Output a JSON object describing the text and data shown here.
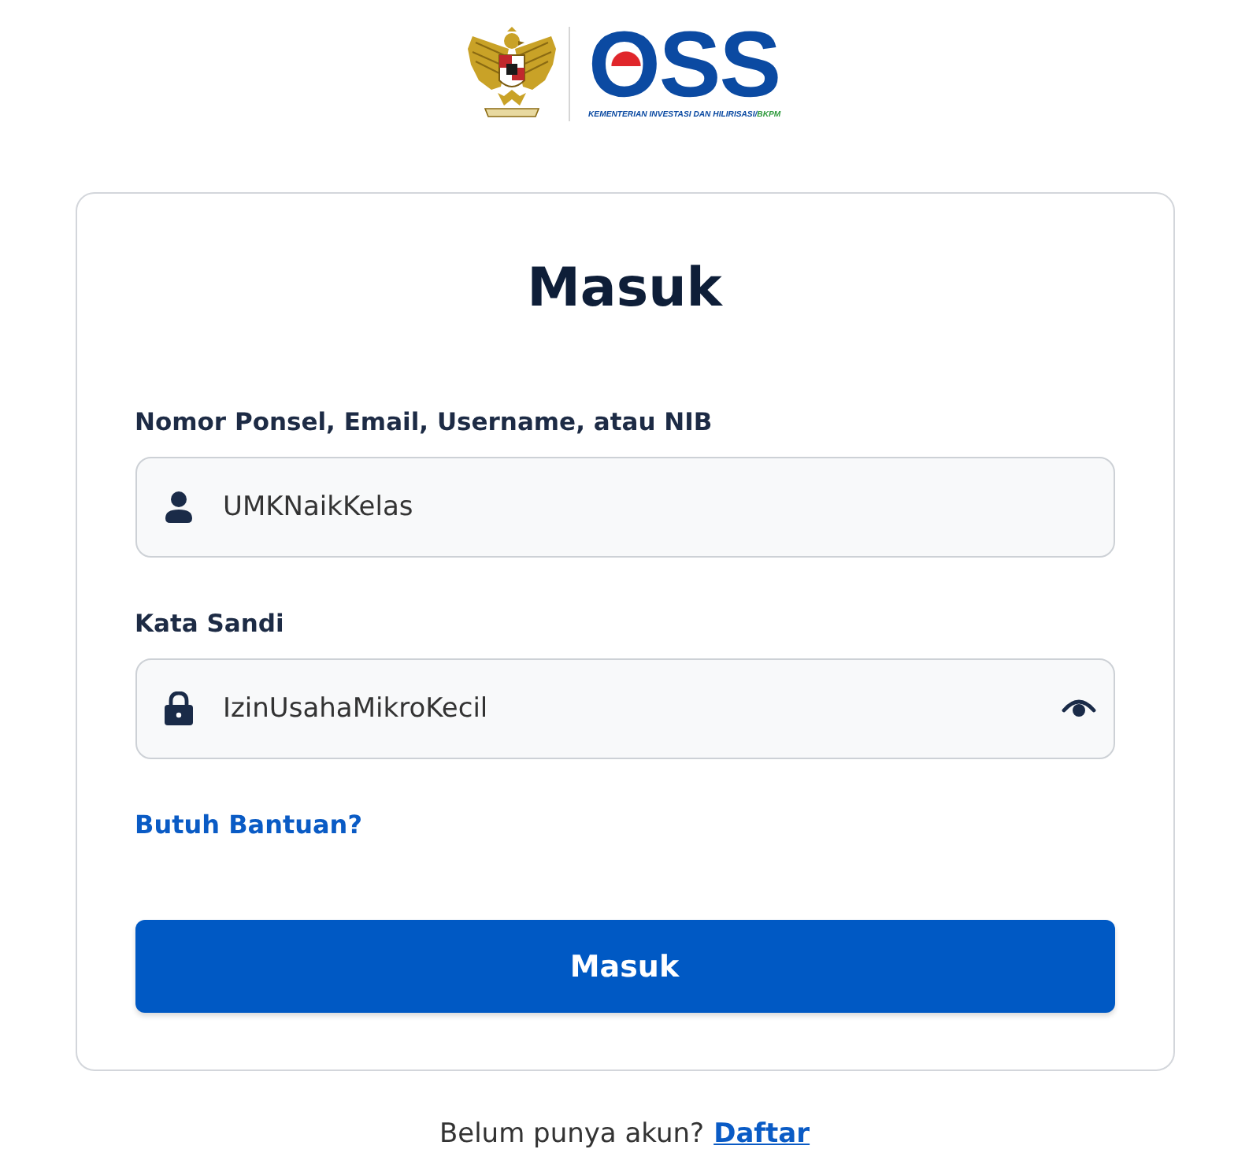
{
  "header": {
    "logo": {
      "wordmark": "OSS",
      "subtitle": "KEMENTERIAN INVESTASI DAN HILIRISASI/",
      "subtitle_suffix": "BKPM"
    }
  },
  "login_card": {
    "title": "Masuk",
    "fields": [
      {
        "kind": "text",
        "label": "Nomor Ponsel, Email, Username, atau NIB",
        "value": "UMKNaikKelas"
      },
      {
        "kind": "password",
        "label": "Kata Sandi",
        "value": "IzinUsahaMikroKecil",
        "revealed": true
      }
    ],
    "help_link": "Butuh Bantuan?",
    "submit_button": "Masuk"
  },
  "footer": {
    "prompt": "Belum punya akun?",
    "link": "Daftar"
  }
}
